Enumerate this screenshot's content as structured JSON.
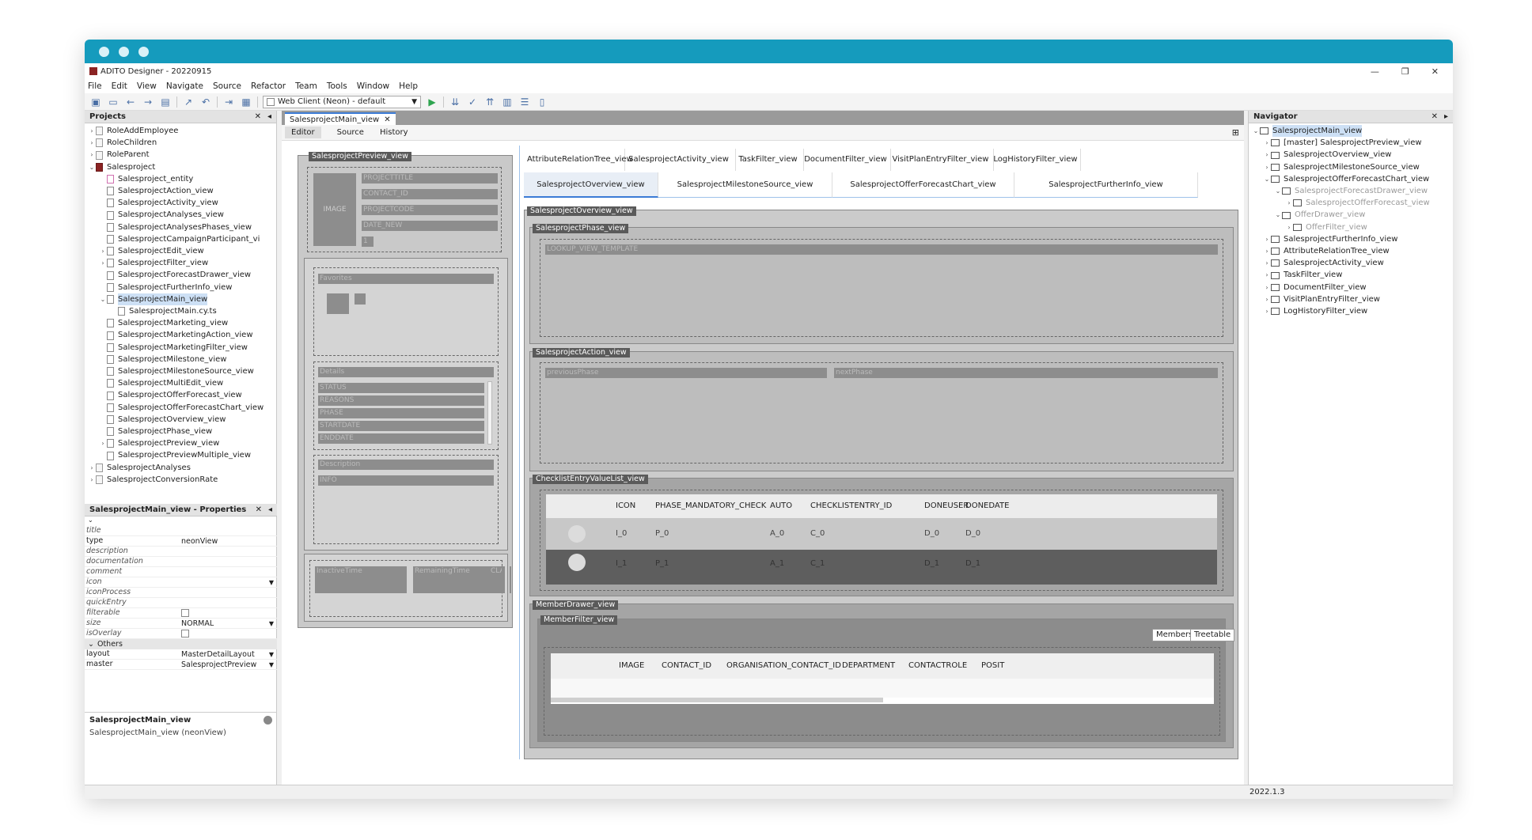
{
  "window": {
    "title": "ADITO Designer - 20220915",
    "controls": [
      "—",
      "❐",
      "✕"
    ]
  },
  "menu": [
    "File",
    "Edit",
    "View",
    "Navigate",
    "Source",
    "Refactor",
    "Team",
    "Tools",
    "Window",
    "Help"
  ],
  "toolbar": {
    "client_combo": "Web Client (Neon) - default"
  },
  "projects": {
    "title": "Projects",
    "items": [
      {
        "label": "RoleAddEmployee",
        "level": 0,
        "toggle": "›",
        "icon": "folder"
      },
      {
        "label": "RoleChildren",
        "level": 0,
        "toggle": "›",
        "icon": "folder"
      },
      {
        "label": "RoleParent",
        "level": 0,
        "toggle": "›",
        "icon": "folder"
      },
      {
        "label": "Salesproject",
        "level": 0,
        "toggle": "⌄",
        "icon": "proj"
      },
      {
        "label": "Salesproject_entity",
        "level": 1,
        "toggle": "",
        "icon": "pink"
      },
      {
        "label": "SalesprojectAction_view",
        "level": 1,
        "toggle": "",
        "icon": "file"
      },
      {
        "label": "SalesprojectActivity_view",
        "level": 1,
        "toggle": "",
        "icon": "file"
      },
      {
        "label": "SalesprojectAnalyses_view",
        "level": 1,
        "toggle": "",
        "icon": "file"
      },
      {
        "label": "SalesprojectAnalysesPhases_view",
        "level": 1,
        "toggle": "",
        "icon": "file"
      },
      {
        "label": "SalesprojectCampaignParticipant_vi",
        "level": 1,
        "toggle": "",
        "icon": "file"
      },
      {
        "label": "SalesprojectEdit_view",
        "level": 1,
        "toggle": "›",
        "icon": "file"
      },
      {
        "label": "SalesprojectFilter_view",
        "level": 1,
        "toggle": "›",
        "icon": "file"
      },
      {
        "label": "SalesprojectForecastDrawer_view",
        "level": 1,
        "toggle": "",
        "icon": "file"
      },
      {
        "label": "SalesprojectFurtherInfo_view",
        "level": 1,
        "toggle": "",
        "icon": "file"
      },
      {
        "label": "SalesprojectMain_view",
        "level": 1,
        "toggle": "⌄",
        "icon": "file",
        "selected": true
      },
      {
        "label": "SalesprojectMain.cy.ts",
        "level": 2,
        "toggle": "",
        "icon": "file"
      },
      {
        "label": "SalesprojectMarketing_view",
        "level": 1,
        "toggle": "",
        "icon": "file"
      },
      {
        "label": "SalesprojectMarketingAction_view",
        "level": 1,
        "toggle": "",
        "icon": "file"
      },
      {
        "label": "SalesprojectMarketingFilter_view",
        "level": 1,
        "toggle": "",
        "icon": "file"
      },
      {
        "label": "SalesprojectMilestone_view",
        "level": 1,
        "toggle": "",
        "icon": "file"
      },
      {
        "label": "SalesprojectMilestoneSource_view",
        "level": 1,
        "toggle": "",
        "icon": "file"
      },
      {
        "label": "SalesprojectMultiEdit_view",
        "level": 1,
        "toggle": "",
        "icon": "file"
      },
      {
        "label": "SalesprojectOfferForecast_view",
        "level": 1,
        "toggle": "",
        "icon": "file"
      },
      {
        "label": "SalesprojectOfferForecastChart_view",
        "level": 1,
        "toggle": "",
        "icon": "file"
      },
      {
        "label": "SalesprojectOverview_view",
        "level": 1,
        "toggle": "",
        "icon": "file"
      },
      {
        "label": "SalesprojectPhase_view",
        "level": 1,
        "toggle": "",
        "icon": "file"
      },
      {
        "label": "SalesprojectPreview_view",
        "level": 1,
        "toggle": "›",
        "icon": "file"
      },
      {
        "label": "SalesprojectPreviewMultiple_view",
        "level": 1,
        "toggle": "",
        "icon": "file"
      },
      {
        "label": "SalesprojectAnalyses",
        "level": 0,
        "toggle": "›",
        "icon": "folder"
      },
      {
        "label": "SalesprojectConversionRate",
        "level": 0,
        "toggle": "›",
        "icon": "folder"
      }
    ]
  },
  "properties": {
    "title": "SalesprojectMain_view - Properties",
    "rows": [
      {
        "key": "title",
        "value": "",
        "italic": true
      },
      {
        "key": "type",
        "value": "neonView",
        "italic": false
      },
      {
        "key": "description",
        "value": "",
        "italic": true
      },
      {
        "key": "documentation",
        "value": "",
        "italic": true
      },
      {
        "key": "comment",
        "value": "",
        "italic": true
      },
      {
        "key": "icon",
        "value": "",
        "italic": true
      },
      {
        "key": "iconProcess",
        "value": "",
        "italic": true
      },
      {
        "key": "quickEntry",
        "value": "",
        "italic": true
      },
      {
        "key": "filterable",
        "value": "",
        "italic": true
      },
      {
        "key": "size",
        "value": "NORMAL",
        "italic": true
      },
      {
        "key": "isOverlay",
        "value": "",
        "italic": true
      }
    ],
    "section": "Others",
    "rows2": [
      {
        "key": "layout",
        "value": "MasterDetailLayout"
      },
      {
        "key": "master",
        "value": "SalesprojectPreview"
      }
    ],
    "desc_title": "SalesprojectMain_view",
    "desc_text": "SalesprojectMain_view (neonView)"
  },
  "editor": {
    "tab": "SalesprojectMain_view",
    "subtabs": [
      "Editor",
      "Source",
      "History"
    ],
    "preview": {
      "tag": "SalesprojectPreview_view",
      "image": "IMAGE",
      "fields": [
        "PROJECTTITLE",
        "CONTACT_ID",
        "PROJECTCODE",
        "DATE_NEW"
      ],
      "count": "1",
      "favorites": "Favorites",
      "details": "Details",
      "detail_fields": [
        "STATUS",
        "REASONS",
        "PHASE",
        "STARTDATE",
        "ENDDATE"
      ],
      "description": "Description",
      "info": "INFO",
      "footer": [
        "InactiveTime",
        "RemainingTime",
        "CLASSIF"
      ]
    },
    "view_tabs_row1": [
      "AttributeRelationTree_view",
      "SalesprojectActivity_view",
      "TaskFilter_view",
      "DocumentFilter_view",
      "VisitPlanEntryFilter_view",
      "LogHistoryFilter_view"
    ],
    "view_tabs_row2": [
      "SalesprojectOverview_view",
      "SalesprojectMilestoneSource_view",
      "SalesprojectOfferForecastChart_view",
      "SalesprojectFurtherInfo_view"
    ],
    "overview": {
      "tag": "SalesprojectOverview_view",
      "phase_tag": "SalesprojectPhase_view",
      "lookup": "LOOKUP_VIEW_TEMPLATE",
      "action_tag": "SalesprojectAction_view",
      "prev": "previousPhase",
      "next": "nextPhase",
      "checklist_tag": "ChecklistEntryValueList_view",
      "table_headers": [
        "ICON",
        "PHASE_MANDATORY_CHECK",
        "AUTO",
        "CHECKLISTENTRY_ID",
        "DONEUSER",
        "DONEDATE"
      ],
      "table_rows": [
        [
          "I_0",
          "P_0",
          "A_0",
          "C_0",
          "D_0",
          "D_0"
        ],
        [
          "I_1",
          "P_1",
          "A_1",
          "C_1",
          "D_1",
          "D_1"
        ]
      ],
      "drawer_tag": "MemberDrawer_view",
      "filter_tag": "MemberFilter_view",
      "btn_members": "Members",
      "btn_treetable": "Treetable",
      "member_headers": [
        "IMAGE",
        "CONTACT_ID",
        "ORGANISATION_CONTACT_ID",
        "DEPARTMENT",
        "CONTACTROLE",
        "POSIT"
      ]
    }
  },
  "navigator": {
    "title": "Navigator",
    "items": [
      {
        "label": "SalesprojectMain_view",
        "level": 0,
        "toggle": "⌄",
        "selected": true,
        "dim": false
      },
      {
        "label": "[master] SalesprojectPreview_view",
        "level": 1,
        "toggle": "›",
        "dim": false,
        "boldprefix": true
      },
      {
        "label": "SalesprojectOverview_view",
        "level": 1,
        "toggle": "›",
        "dim": false
      },
      {
        "label": "SalesprojectMilestoneSource_view",
        "level": 1,
        "toggle": "›",
        "dim": false
      },
      {
        "label": "SalesprojectOfferForecastChart_view",
        "level": 1,
        "toggle": "⌄",
        "dim": false
      },
      {
        "label": "SalesprojectForecastDrawer_view",
        "level": 2,
        "toggle": "⌄",
        "dim": true
      },
      {
        "label": "SalesprojectOfferForecast_view",
        "level": 3,
        "toggle": "›",
        "dim": true
      },
      {
        "label": "OfferDrawer_view",
        "level": 2,
        "toggle": "⌄",
        "dim": true
      },
      {
        "label": "OfferFilter_view",
        "level": 3,
        "toggle": "›",
        "dim": true
      },
      {
        "label": "SalesprojectFurtherInfo_view",
        "level": 1,
        "toggle": "›",
        "dim": false
      },
      {
        "label": "AttributeRelationTree_view",
        "level": 1,
        "toggle": "›",
        "dim": false
      },
      {
        "label": "SalesprojectActivity_view",
        "level": 1,
        "toggle": "›",
        "dim": false
      },
      {
        "label": "TaskFilter_view",
        "level": 1,
        "toggle": "›",
        "dim": false
      },
      {
        "label": "DocumentFilter_view",
        "level": 1,
        "toggle": "›",
        "dim": false
      },
      {
        "label": "VisitPlanEntryFilter_view",
        "level": 1,
        "toggle": "›",
        "dim": false
      },
      {
        "label": "LogHistoryFilter_view",
        "level": 1,
        "toggle": "›",
        "dim": false
      }
    ]
  },
  "status": {
    "version": "2022.1.3"
  }
}
